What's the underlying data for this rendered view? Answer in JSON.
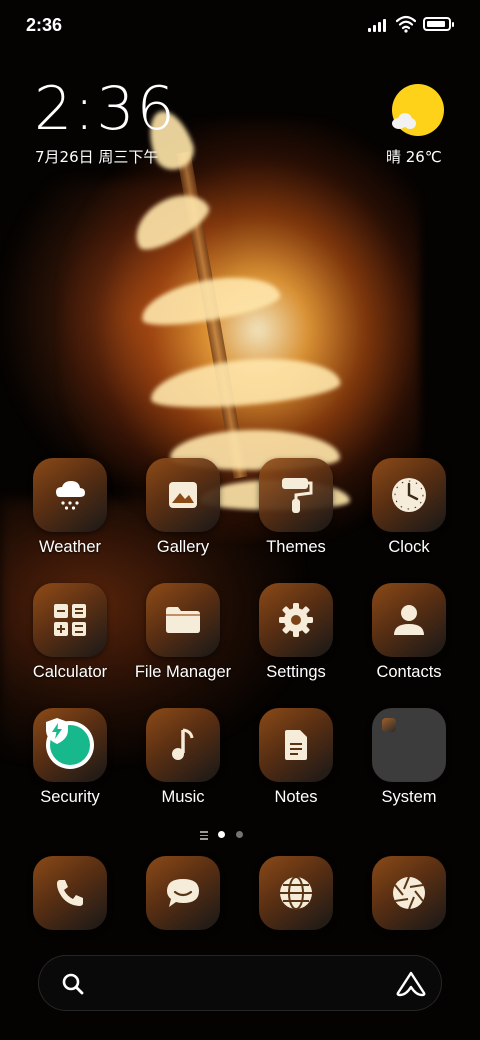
{
  "status_bar": {
    "time": "2:36"
  },
  "clock_widget": {
    "time": "2:36",
    "date": "7月26日 周三下午"
  },
  "weather_widget": {
    "condition_temp": "晴 26℃"
  },
  "apps": [
    {
      "label": "Weather",
      "icon": "weather-snow-cloud-icon"
    },
    {
      "label": "Gallery",
      "icon": "gallery-image-icon"
    },
    {
      "label": "Themes",
      "icon": "paint-roller-icon"
    },
    {
      "label": "Clock",
      "icon": "clock-icon"
    },
    {
      "label": "Calculator",
      "icon": "calculator-icon"
    },
    {
      "label": "File Manager",
      "icon": "folder-icon"
    },
    {
      "label": "Settings",
      "icon": "gear-icon"
    },
    {
      "label": "Contacts",
      "icon": "person-icon"
    },
    {
      "label": "Security",
      "icon": "shield-lightning-icon"
    },
    {
      "label": "Music",
      "icon": "music-note-icon"
    },
    {
      "label": "Notes",
      "icon": "document-icon"
    },
    {
      "label": "System",
      "icon": "folder-icon"
    }
  ],
  "page_indicator": {
    "total_pages": 2,
    "active_page": 1
  },
  "dock": [
    {
      "icon": "phone-icon"
    },
    {
      "icon": "message-bubble-icon"
    },
    {
      "icon": "globe-browser-icon"
    },
    {
      "icon": "camera-aperture-icon"
    }
  ],
  "colors": {
    "sun": "#ffd21a",
    "security_green": "#17b88c",
    "icon_warm": "#9a5420"
  }
}
